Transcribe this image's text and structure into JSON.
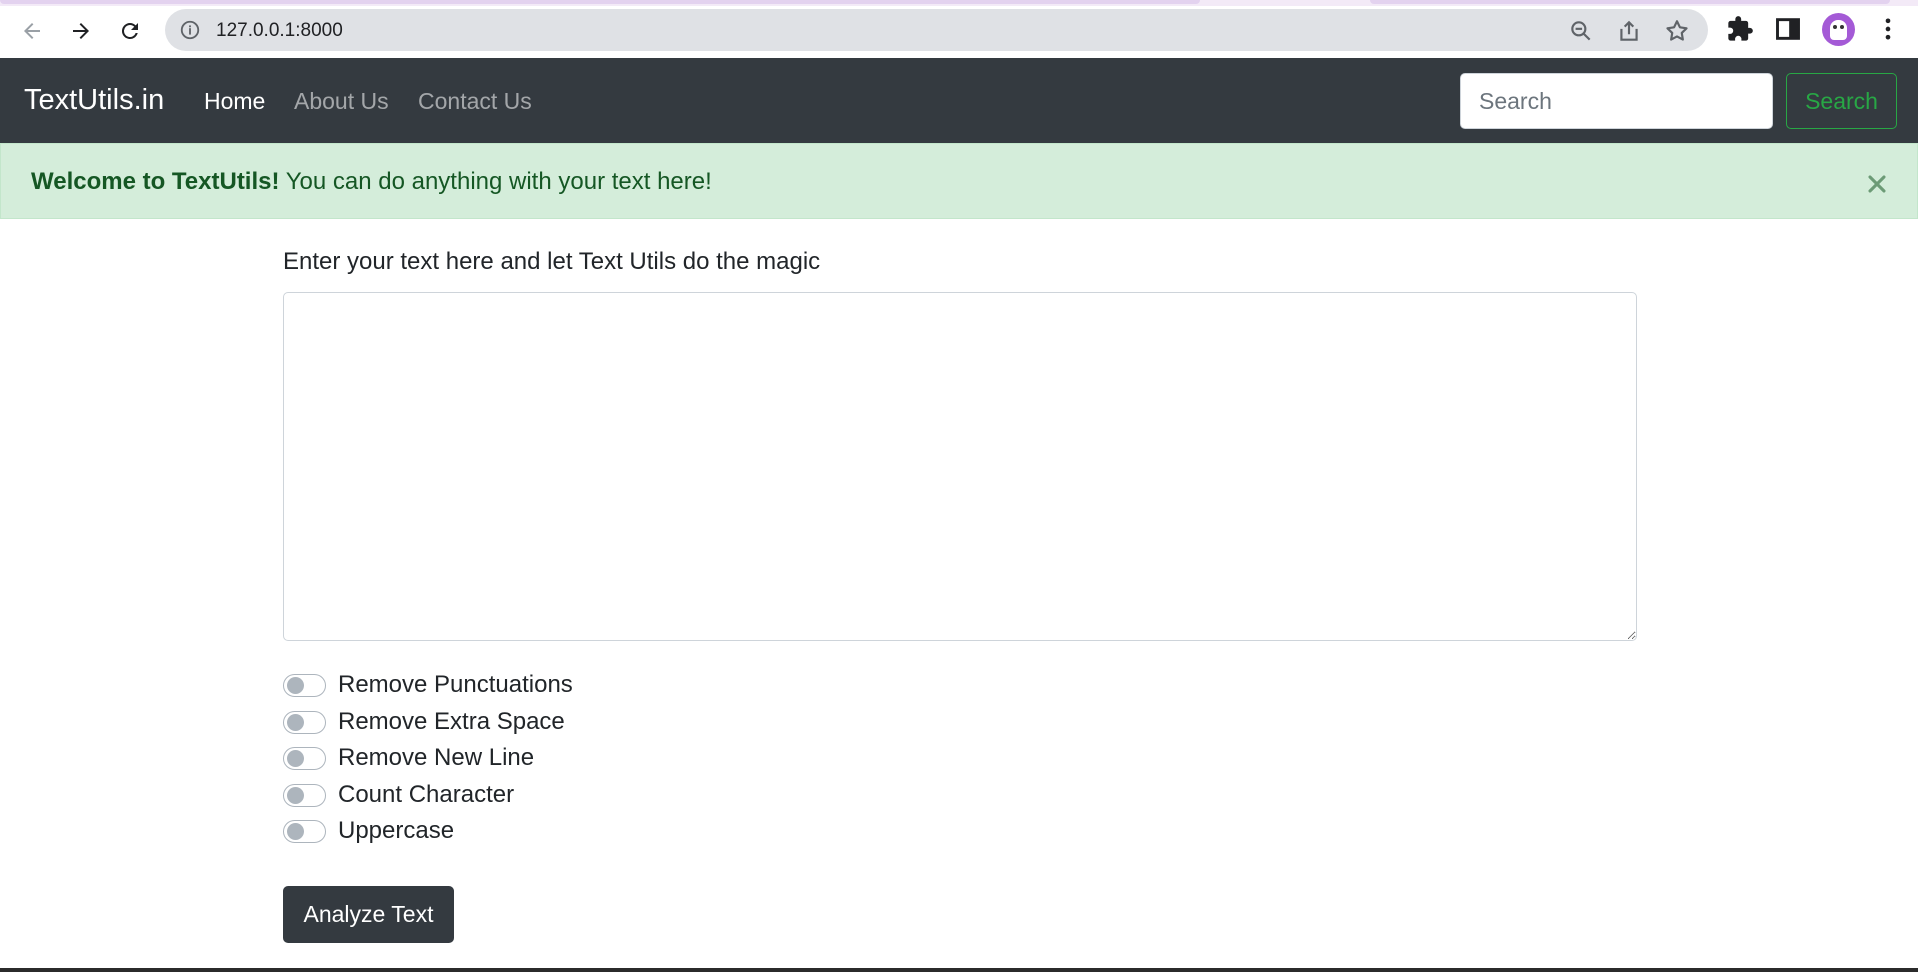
{
  "browser": {
    "url": "127.0.0.1:8000",
    "icons": {
      "back": "back-arrow-icon",
      "forward": "forward-arrow-icon",
      "reload": "reload-icon",
      "info": "info-icon",
      "zoom": "zoom-out-icon",
      "share": "share-icon",
      "bookmark": "star-icon",
      "extensions": "puzzle-icon",
      "sidepanel": "side-panel-icon",
      "profile": "avatar",
      "menu": "kebab-menu-icon"
    }
  },
  "navbar": {
    "brand": "TextUtils.in",
    "links": [
      {
        "label": "Home",
        "active": true
      },
      {
        "label": "About Us",
        "active": false
      },
      {
        "label": "Contact Us",
        "active": false
      }
    ],
    "search_placeholder": "Search",
    "search_button": "Search"
  },
  "alert": {
    "strong": "Welcome to TextUtils!",
    "message": " You can do anything with your text here!"
  },
  "main": {
    "label": "Enter your text here and let Text Utils do the magic",
    "textarea_value": "",
    "switches": [
      {
        "label": "Remove Punctuations",
        "checked": false
      },
      {
        "label": "Remove Extra Space",
        "checked": false
      },
      {
        "label": "Remove New Line",
        "checked": false
      },
      {
        "label": "Count Character",
        "checked": false
      },
      {
        "label": "Uppercase",
        "checked": false
      }
    ],
    "analyze_button": "Analyze Text"
  },
  "colors": {
    "navbar_bg": "#343a40",
    "alert_bg": "#d4edda",
    "alert_text": "#155724",
    "success": "#28a745"
  }
}
